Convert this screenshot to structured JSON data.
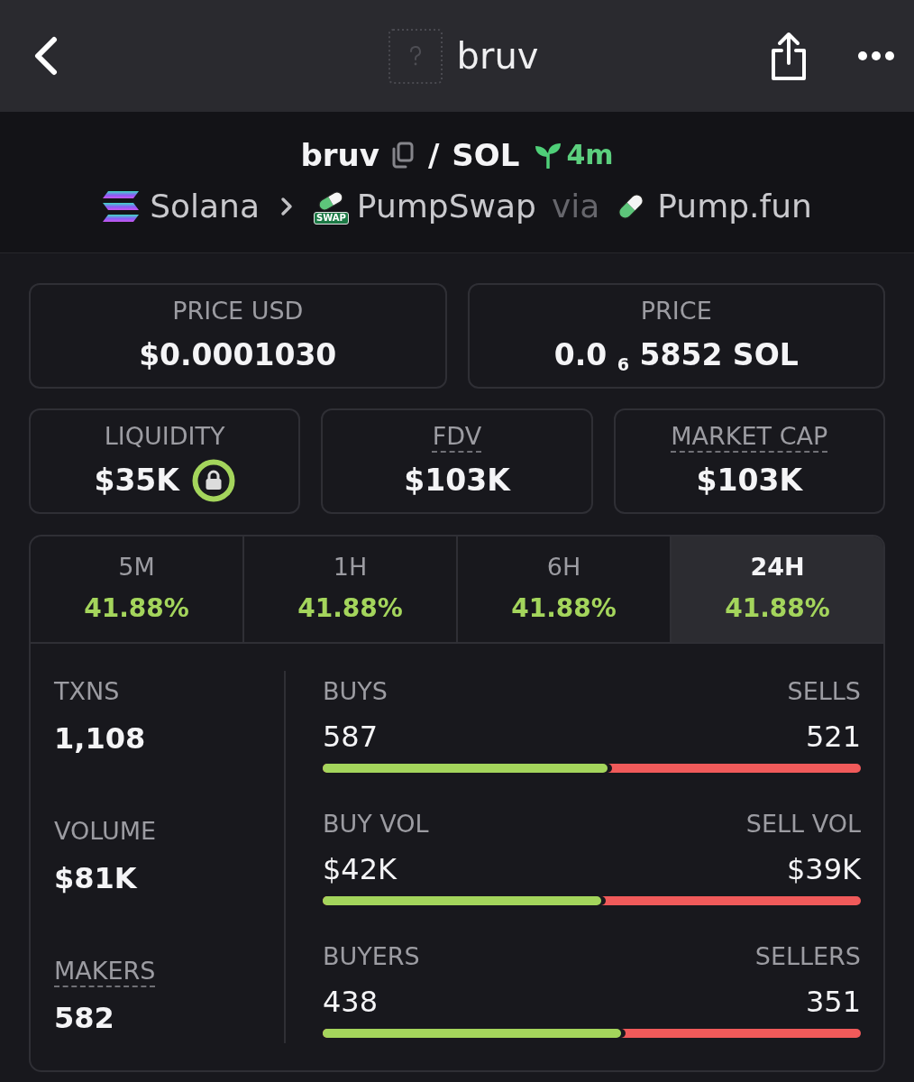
{
  "top_bar": {
    "title": "bruv"
  },
  "pair": {
    "base": "bruv",
    "separator": "/",
    "quote": "SOL",
    "age": "4m"
  },
  "route": {
    "chain": "Solana",
    "dex_badge": "SWAP",
    "dex": "PumpSwap",
    "via": "via",
    "launchpad": "Pump.fun"
  },
  "stat_rows": [
    [
      {
        "label": "PRICE USD",
        "value": "$0.0001030",
        "tooltip": false,
        "locked": false
      },
      {
        "label": "PRICE",
        "value": "0.0 $_{6}$ 5852 SOL",
        "tooltip": false,
        "locked": false
      }
    ],
    [
      {
        "label": "LIQUIDITY",
        "value": "$35K",
        "tooltip": false,
        "locked": true
      },
      {
        "label": "FDV",
        "value": "$103K",
        "tooltip": true,
        "locked": false
      },
      {
        "label": "MARKET CAP",
        "value": "$103K",
        "tooltip": true,
        "locked": false
      }
    ]
  ],
  "period_tabs": [
    {
      "label": "5M",
      "change": "41.88%",
      "selected": false
    },
    {
      "label": "1H",
      "change": "41.88%",
      "selected": false
    },
    {
      "label": "6H",
      "change": "41.88%",
      "selected": false
    },
    {
      "label": "24H",
      "change": "41.88%",
      "selected": true
    }
  ],
  "totals": [
    {
      "label": "TXNS",
      "value": "1,108",
      "tooltip": false
    },
    {
      "label": "VOLUME",
      "value": "$81K",
      "tooltip": false
    },
    {
      "label": "MAKERS",
      "value": "582",
      "tooltip": true
    }
  ],
  "split_bars": [
    {
      "buy_label": "BUYS",
      "buy_value": "587",
      "sell_label": "SELLS",
      "sell_value": "521",
      "level": 0.53
    },
    {
      "buy_label": "BUY VOL",
      "buy_value": "$42K",
      "sell_label": "SELL VOL",
      "sell_value": "$39K",
      "level": 0.518
    },
    {
      "buy_label": "BUYERS",
      "buy_value": "438",
      "sell_label": "SELLERS",
      "sell_value": "351",
      "level": 0.555
    }
  ]
}
